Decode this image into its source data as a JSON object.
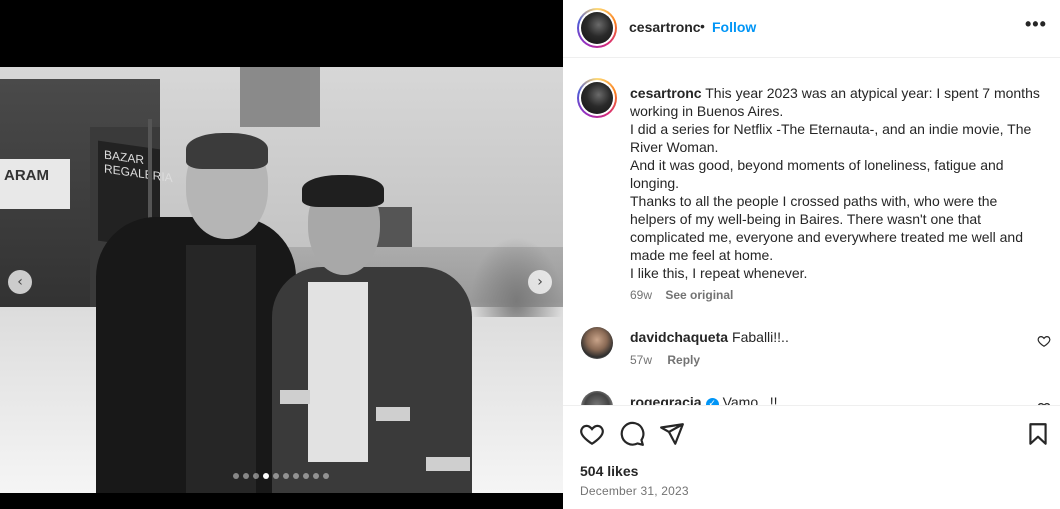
{
  "post": {
    "username": "cesartronc",
    "follow_label": "Follow",
    "separator": "•",
    "more_icon": "•••"
  },
  "carousel": {
    "total_slides": 10,
    "active_slide": 3,
    "prev_icon": "‹",
    "next_icon": "›",
    "photo_signs": [
      "ARAM",
      "BAZAR REGALERIA"
    ]
  },
  "caption": {
    "username": "cesartronc",
    "lines": [
      "This year 2023 was an atypical year: I spent 7 months working in Buenos Aires.",
      "I did a series for Netflix -The Eternauta-, and an indie movie, The River Woman.",
      "And it was good, beyond moments of loneliness, fatigue and longing.",
      "Thanks to all the people I crossed paths with, who were the helpers of my well-being in Baires. There wasn't one that complicated me, everyone and everywhere treated me well and made me feel at home.",
      "I like this, I repeat whenever."
    ],
    "age": "69w",
    "see_original": "See original"
  },
  "comments": [
    {
      "username": "davidchaqueta",
      "text": "Faballi!!..",
      "age": "57w",
      "reply_label": "Reply",
      "verified": false
    },
    {
      "username": "rogegracia",
      "text": "Vamo...!!",
      "verified": true
    }
  ],
  "footer": {
    "likes": "504 likes",
    "date": "December 31, 2023"
  }
}
